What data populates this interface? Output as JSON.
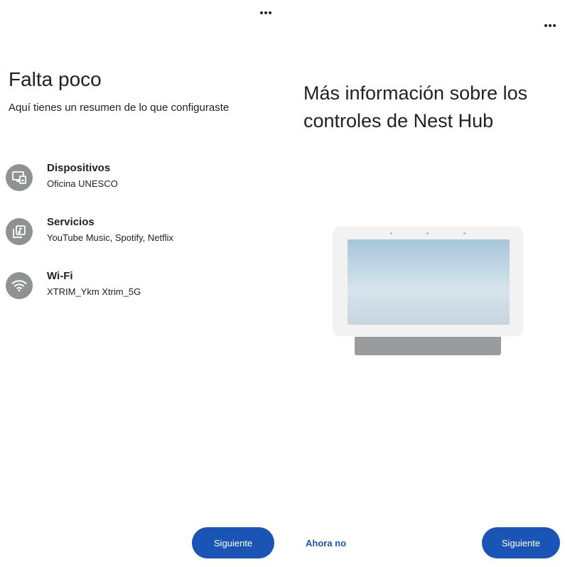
{
  "left_screen": {
    "title": "Falta poco",
    "subtitle": "Aquí tienes un resumen de lo que configuraste",
    "items": [
      {
        "icon": "devices-icon",
        "title": "Dispositivos",
        "value": "Oficina UNESCO"
      },
      {
        "icon": "services-icon",
        "title": "Servicios",
        "value": "YouTube Music, Spotify, Netflix"
      },
      {
        "icon": "wifi-icon",
        "title": "Wi-Fi",
        "value": "XTRIM_Ykm Xtrim_5G"
      }
    ],
    "next_label": "Siguiente"
  },
  "right_screen": {
    "title": "Más información sobre los controles de Nest Hub",
    "skip_label": "Ahora no",
    "next_label": "Siguiente"
  },
  "colors": {
    "primary": "#1a55b5",
    "icon_bg": "#8f9193",
    "text": "#202124"
  }
}
